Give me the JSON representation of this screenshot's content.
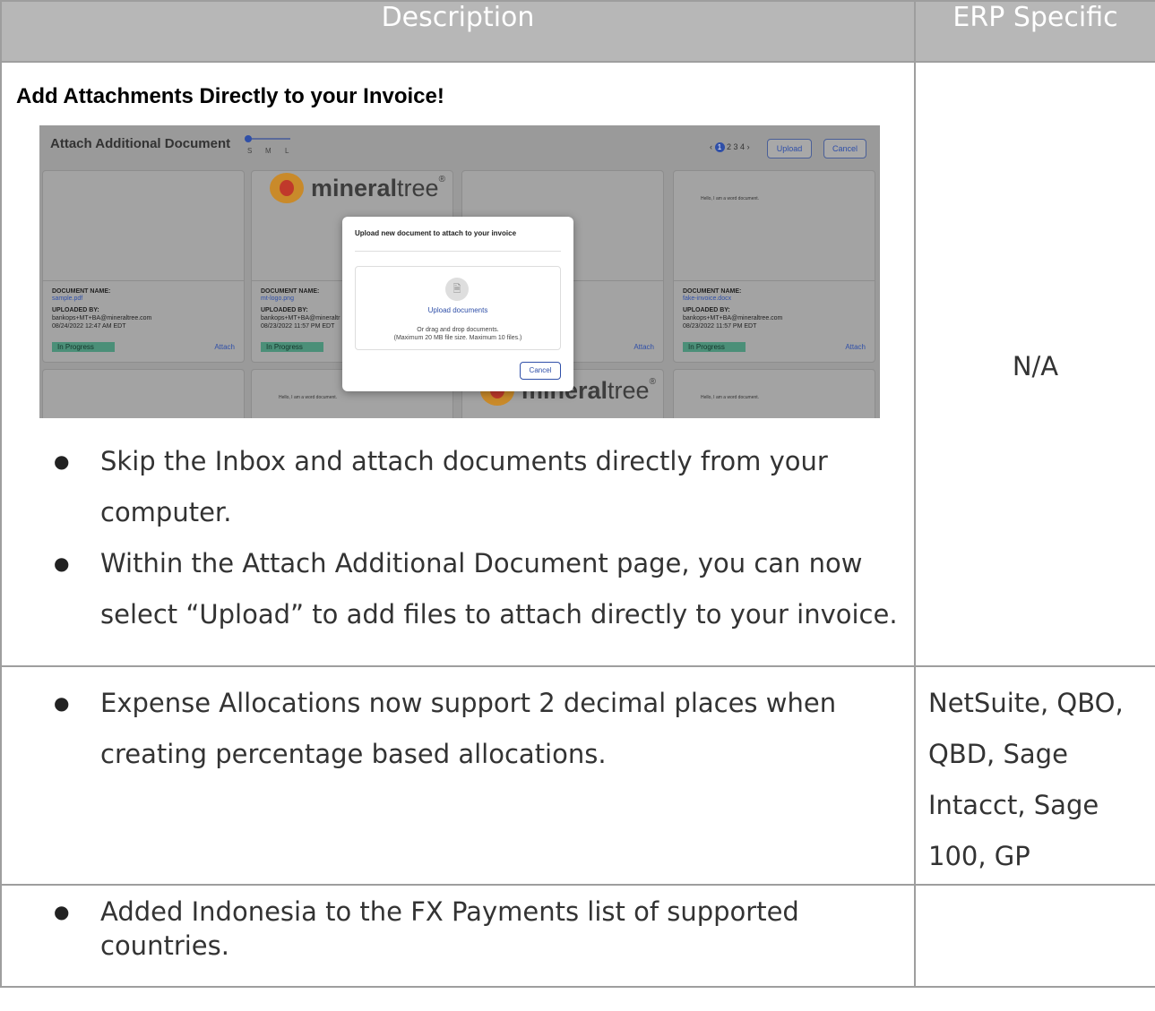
{
  "header": {
    "description": "Description",
    "erp": "ERP Specific"
  },
  "row1": {
    "title": "Add Attachments Directly to your Invoice!",
    "bullets": [
      "Skip the Inbox and attach documents directly from your computer.",
      "Within the Attach Additional Document page, you can now select “Upload” to add files to attach directly to your invoice."
    ],
    "erp": "N/A",
    "screenshot": {
      "title": "Attach Additional Document",
      "sizes": [
        "S",
        "M",
        "L"
      ],
      "pager_prev": "‹",
      "pager_current": "1",
      "pager_rest": "2  3  4",
      "pager_next": "›",
      "upload_btn": "Upload",
      "cancel_btn": "Cancel",
      "doc_name_label": "DOCUMENT NAME:",
      "uploaded_by_label": "UPLOADED BY:",
      "status": "In Progress",
      "attach": "Attach",
      "logo_word_a": "mineral",
      "logo_word_b": "tree",
      "logo_reg": "®",
      "word_doc_text": "Hello, I am a word document.",
      "cards": [
        {
          "name": "sample.pdf",
          "by": "bankops+MT+BA@mineraltree.com",
          "date": "08/24/2022 12:47 AM EDT"
        },
        {
          "name": "mt-logo.png",
          "by": "bankops+MT+BA@mineraltr",
          "date": "08/23/2022 11:57 PM EDT"
        },
        {
          "name": "fake-invoice.docx",
          "by": "bankops+MT+BA@mineraltree.com",
          "date": "08/23/2022 11:57 PM EDT"
        }
      ],
      "modal": {
        "title": "Upload new document to attach to your invoice",
        "file_icon": "🗎",
        "link": "Upload documents",
        "hint1": "Or drag and drop documents.",
        "hint2": "(Maximum 20 MB file size. Maximum 10 files.)",
        "cancel": "Cancel"
      }
    }
  },
  "row2": {
    "bullets": [
      "Expense Allocations now support 2 decimal places when creating percentage based allocations."
    ],
    "erp_lines": [
      "NetSuite, QBO,",
      "QBD, Sage",
      "Intacct, Sage",
      "100, GP"
    ]
  },
  "row3": {
    "bullets": [
      "Added Indonesia to the FX Payments list of supported countries."
    ],
    "erp": ""
  }
}
